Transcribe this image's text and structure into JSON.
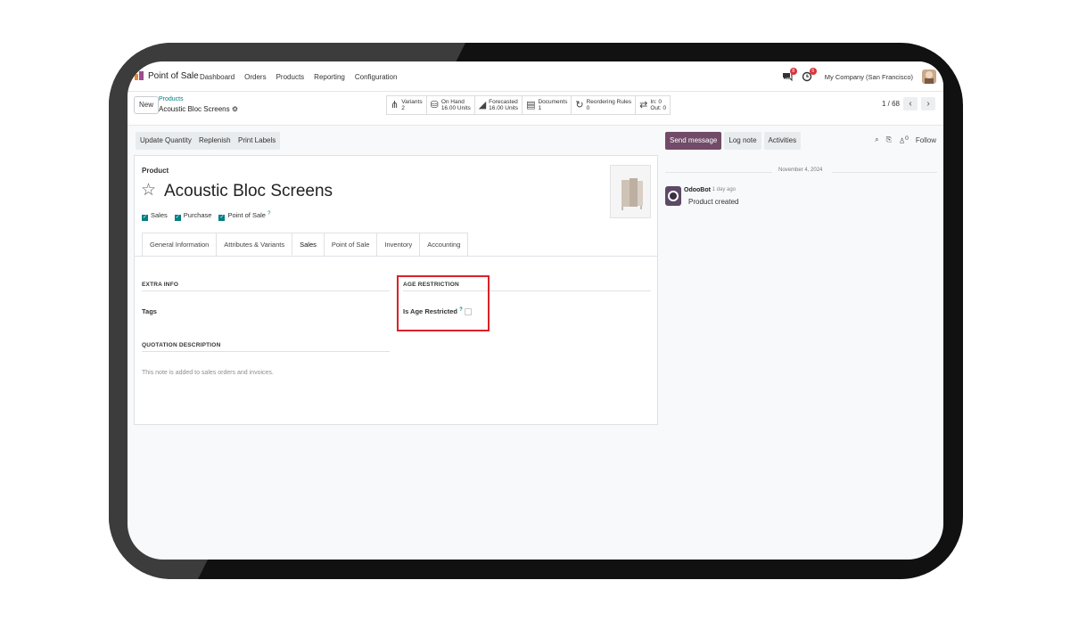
{
  "nav": {
    "app_name": "Point of Sale",
    "menu": [
      "Dashboard",
      "Orders",
      "Products",
      "Reporting",
      "Configuration"
    ],
    "chat_badge": "8",
    "activity_badge": "6",
    "company": "My Company (San Francisco)"
  },
  "control": {
    "new_label": "New",
    "breadcrumb_parent": "Products",
    "breadcrumb_current": "Acoustic Bloc Screens",
    "smart_buttons": [
      {
        "label": "Variants",
        "value": "2",
        "icon": "sitemap-icon"
      },
      {
        "label": "On Hand",
        "value": "16.00 Units",
        "icon": "cubes-icon"
      },
      {
        "label": "Forecasted",
        "value": "16.00 Units",
        "icon": "area-chart-icon"
      },
      {
        "label": "Documents",
        "value": "1",
        "icon": "file-icon"
      },
      {
        "label": "Reordering Rules",
        "value": "0",
        "icon": "refresh-icon"
      },
      {
        "label": "In: 0",
        "value": "Out: 0",
        "icon": "exchange-icon"
      }
    ],
    "pager": "1 / 68"
  },
  "actions": {
    "update_quantity": "Update Quantity",
    "replenish": "Replenish",
    "print_labels": "Print Labels"
  },
  "form": {
    "product_label": "Product",
    "product_name": "Acoustic Bloc Screens",
    "checks": [
      "Sales",
      "Purchase",
      "Point of Sale"
    ],
    "help_mark": "?",
    "tabs": [
      "General Information",
      "Attributes & Variants",
      "Sales",
      "Point of Sale",
      "Inventory",
      "Accounting"
    ],
    "active_tab": "Sales",
    "extra_info_title": "EXTRA INFO",
    "tags_label": "Tags",
    "age_restriction_title": "AGE RESTRICTION",
    "is_age_restricted_label": "Is Age Restricted",
    "is_age_restricted": false,
    "quotation_title": "QUOTATION DESCRIPTION",
    "quotation_placeholder": "This note is added to sales orders and invoices."
  },
  "chatter": {
    "send_message": "Send message",
    "log_note": "Log note",
    "activities": "Activities",
    "followers_count": "0",
    "follow": "Follow",
    "date": "November 4, 2024",
    "author": "OdooBot",
    "time": "- 1 day ago",
    "message": "Product created"
  },
  "colors": {
    "brand": "#714b67",
    "teal": "#017e84",
    "highlight": "#d9222a"
  }
}
